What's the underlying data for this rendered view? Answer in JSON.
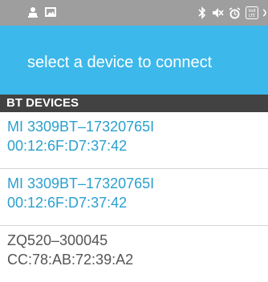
{
  "colors": {
    "status_bar": "#9e9e9e",
    "app_bar": "#3cb8ea",
    "section_header": "#424242",
    "paired_text": "#2aa0cf",
    "unpaired_text": "#555555"
  },
  "status_bar": {
    "left_icons": [
      "person-notification-icon",
      "image-notification-icon"
    ],
    "right_icons": [
      "bluetooth-icon",
      "mute-icon",
      "alarm-icon",
      "volte-icon",
      "wifi-icon"
    ],
    "volte_text": "Vo8 LTE"
  },
  "app_bar": {
    "title": "select a device to connect"
  },
  "list": {
    "header": "BT DEVICES",
    "devices": [
      {
        "name": "MI 3309BT–17320765I",
        "address": "00:12:6F:D7:37:42",
        "color": "#2aa0cf"
      },
      {
        "name": "MI 3309BT–17320765I",
        "address": "00:12:6F:D7:37:42",
        "color": "#2aa0cf"
      },
      {
        "name": "ZQ520–300045",
        "address": "CC:78:AB:72:39:A2",
        "color": "#555555"
      }
    ]
  }
}
